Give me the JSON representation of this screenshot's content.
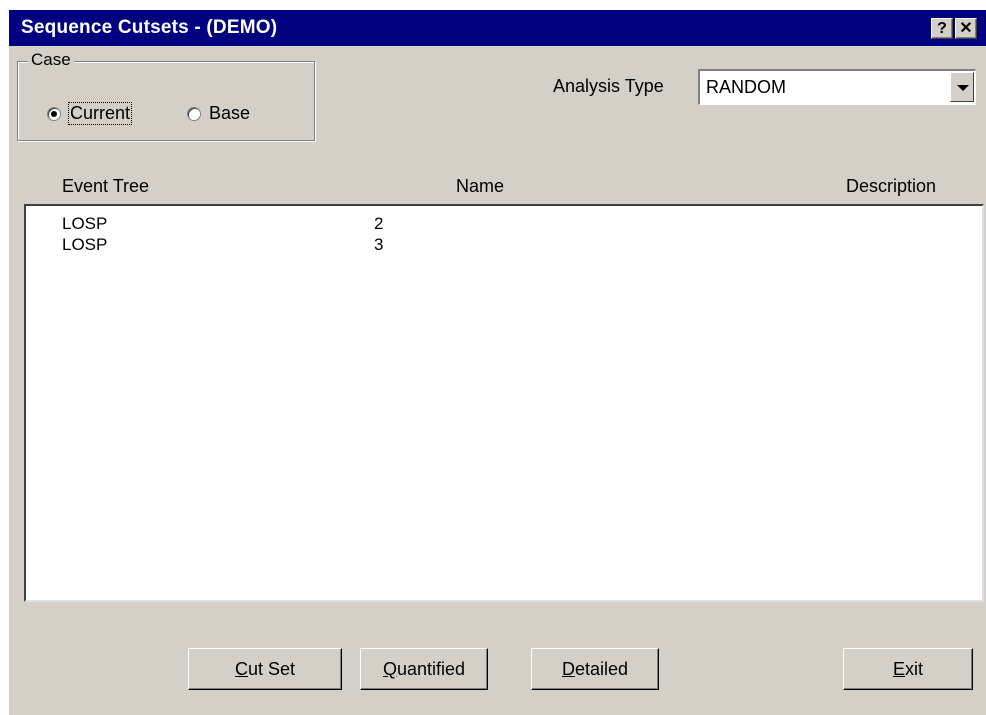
{
  "window": {
    "title": "Sequence Cutsets  -  (DEMO)",
    "help_glyph": "?",
    "close_glyph": "✕"
  },
  "case_group": {
    "legend": "Case",
    "options": [
      {
        "label": "Current",
        "checked": true
      },
      {
        "label": "Base",
        "checked": false
      }
    ]
  },
  "analysis": {
    "label": "Analysis Type",
    "value": "RANDOM"
  },
  "list": {
    "columns": [
      "Event Tree",
      "Name",
      "Description"
    ],
    "rows": [
      {
        "event_tree": "LOSP",
        "name": "2",
        "description": ""
      },
      {
        "event_tree": "LOSP",
        "name": "3",
        "description": ""
      }
    ]
  },
  "buttons": {
    "cut_set": {
      "mnemonic": "C",
      "rest": "ut Set"
    },
    "quantified": {
      "mnemonic": "Q",
      "rest": "uantified"
    },
    "detailed": {
      "mnemonic": "D",
      "rest": "etailed"
    },
    "exit": {
      "mnemonic": "E",
      "rest": "xit"
    }
  },
  "colors": {
    "titlebar": "#000080",
    "face": "#d4d0c8"
  }
}
